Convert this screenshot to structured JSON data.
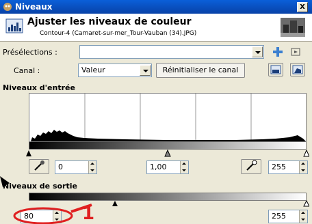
{
  "window": {
    "title": "Niveaux",
    "close_label": "X"
  },
  "header": {
    "title": "Ajuster les niveaux de couleur",
    "subtitle": "Contour-4 (Camaret-sur-mer_Tour-Vauban (34).JPG)"
  },
  "presets": {
    "label": "Présélections :",
    "value": ""
  },
  "channel": {
    "label": "Canal :",
    "value": "Valeur",
    "reset_label": "Réinitialiser le canal"
  },
  "input_levels": {
    "label": "Niveaux d'entrée",
    "low": "0",
    "gamma": "1,00",
    "high": "255"
  },
  "output_levels": {
    "label": "Niveaux de sortie",
    "low": "80",
    "high": "255"
  },
  "annotation": {
    "number": "1",
    "color": "#e02020"
  },
  "colors": {
    "titlebar": "#0a5fd8",
    "annotation": "#e02020"
  }
}
